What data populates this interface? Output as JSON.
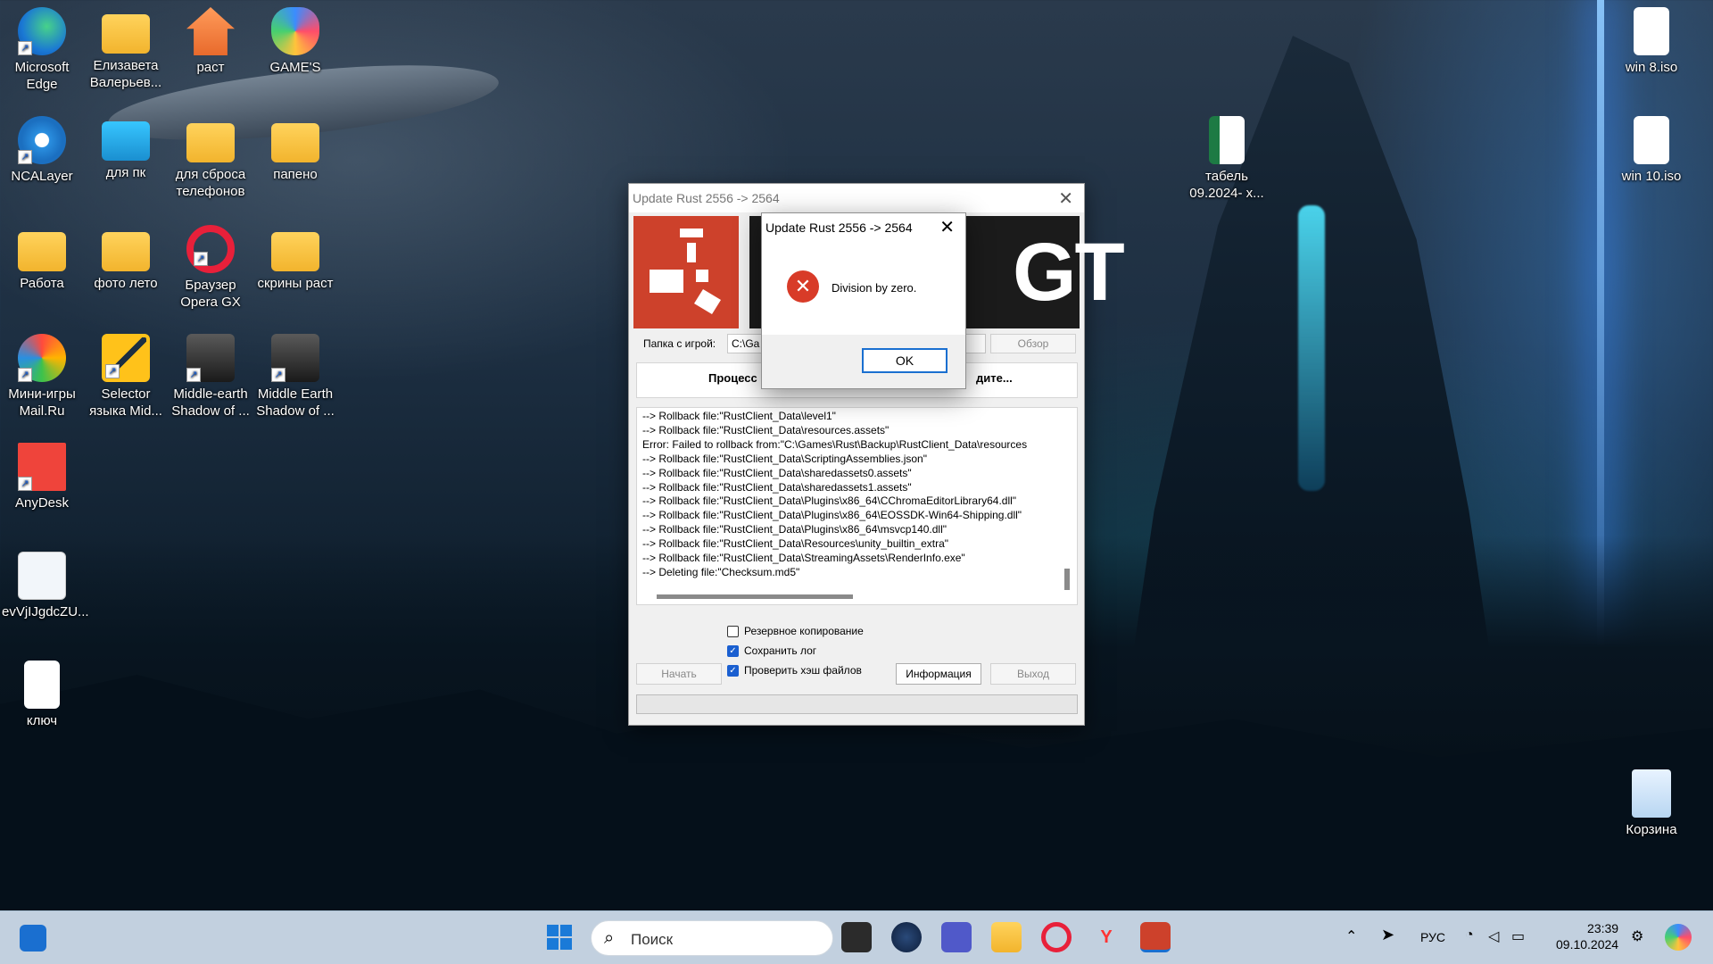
{
  "desktop_icons": [
    {
      "label": "Microsoft Edge",
      "icon": "edge-icon"
    },
    {
      "label": "Елизавета Валерьев...",
      "icon": "folder-icon"
    },
    {
      "label": "раст",
      "icon": "home-folder-icon"
    },
    {
      "label": "GAME'S",
      "icon": "butterfly-icon"
    },
    {
      "label": "NCALayer",
      "icon": "ncalayer-icon"
    },
    {
      "label": "для пк",
      "icon": "monitor-icon"
    },
    {
      "label": "для сброса телефонов",
      "icon": "folder-icon"
    },
    {
      "label": "папено",
      "icon": "folder-icon"
    },
    {
      "label": "Работа",
      "icon": "folder-icon"
    },
    {
      "label": "фото лето",
      "icon": "folder-icon"
    },
    {
      "label": "Браузер Opera GX",
      "icon": "opera-gx-icon"
    },
    {
      "label": "скрины раст",
      "icon": "folder-icon"
    },
    {
      "label": "Мини-игры Mail.Ru",
      "icon": "mailru-games-icon"
    },
    {
      "label": "Selector языка Mid...",
      "icon": "selector-icon"
    },
    {
      "label": "Middle-earth Shadow of ...",
      "icon": "middle-earth-icon"
    },
    {
      "label": "Middle Earth Shadow of ...",
      "icon": "middle-earth-icon"
    },
    {
      "label": "AnyDesk",
      "icon": "anydesk-icon"
    },
    {
      "label": "evVjIJgdcZU...",
      "icon": "image-file-icon"
    },
    {
      "label": "ключ",
      "icon": "text-file-icon"
    },
    {
      "label": "win 8.iso",
      "icon": "iso-file-icon"
    },
    {
      "label": "табель 09.2024- x...",
      "icon": "excel-file-icon"
    },
    {
      "label": "win 10.iso",
      "icon": "iso-file-icon"
    },
    {
      "label": "Корзина",
      "icon": "recycle-bin-icon"
    }
  ],
  "app": {
    "title": "Update Rust 2556 -> 2564",
    "logo_text": "GT",
    "folder_label": "Папка с игрой:",
    "folder_value": "C:\\Ga",
    "browse_label": "Обзор",
    "status_left": "Процесс",
    "status_right": "дите...",
    "log_lines": [
      "--> Rollback file:\"RustClient_Data\\level1\"",
      "--> Rollback file:\"RustClient_Data\\resources.assets\"",
      "Error: Failed to rollback from:\"C:\\Games\\Rust\\Backup\\RustClient_Data\\resources",
      "--> Rollback file:\"RustClient_Data\\ScriptingAssemblies.json\"",
      "--> Rollback file:\"RustClient_Data\\sharedassets0.assets\"",
      "--> Rollback file:\"RustClient_Data\\sharedassets1.assets\"",
      "--> Rollback file:\"RustClient_Data\\Plugins\\x86_64\\CChromaEditorLibrary64.dll\"",
      "--> Rollback file:\"RustClient_Data\\Plugins\\x86_64\\EOSSDK-Win64-Shipping.dll\"",
      "--> Rollback file:\"RustClient_Data\\Plugins\\x86_64\\msvcp140.dll\"",
      "--> Rollback file:\"RustClient_Data\\Resources\\unity_builtin_extra\"",
      "--> Rollback file:\"RustClient_Data\\StreamingAssets\\RenderInfo.exe\"",
      "--> Deleting file:\"Checksum.md5\""
    ],
    "checkboxes": [
      {
        "label": "Резервное копирование",
        "checked": false
      },
      {
        "label": "Сохранить лог",
        "checked": true
      },
      {
        "label": "Проверить хэш файлов",
        "checked": true
      }
    ],
    "start_label": "Начать",
    "info_label": "Информация",
    "exit_label": "Выход"
  },
  "message_box": {
    "title": "Update Rust 2556 -> 2564",
    "text": "Division by zero.",
    "ok_label": "OK"
  },
  "taskbar": {
    "search_placeholder": "Поиск",
    "language": "РУС",
    "time": "23:39",
    "date": "09.10.2024"
  }
}
